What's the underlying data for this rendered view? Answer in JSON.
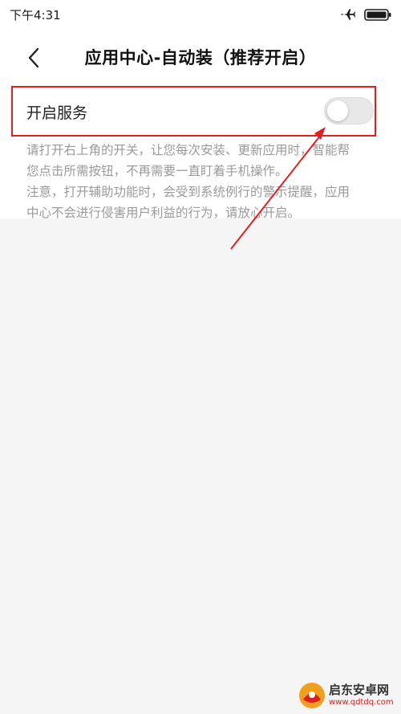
{
  "status_bar": {
    "time": "下午4:31",
    "icons": [
      "airplane-icon",
      "battery-icon"
    ]
  },
  "header": {
    "back_icon": "chevron-left-icon",
    "title": "应用中心-自动装（推荐开启）"
  },
  "service_row": {
    "label": "开启服务",
    "toggle_state": "off"
  },
  "description": {
    "lines": [
      "请打开右上角的开关，让您每次安装、更新应用时，智能帮",
      "您点击所需按钮，不再需要一直盯着手机操作。",
      "注意，打开辅助功能时，会受到系统例行的警示提醒，应用",
      "中心不会进行侵害用户利益的行为，请放心开启。"
    ]
  },
  "annotation": {
    "color": "#e02020"
  },
  "watermark": {
    "name": "启东安卓网",
    "url": "www.qdtdq.com"
  },
  "colors": {
    "background": "#f5f5f5",
    "surface": "#ffffff",
    "description_text": "#9a9a9a",
    "toggle_off": "#e8e8e8"
  }
}
